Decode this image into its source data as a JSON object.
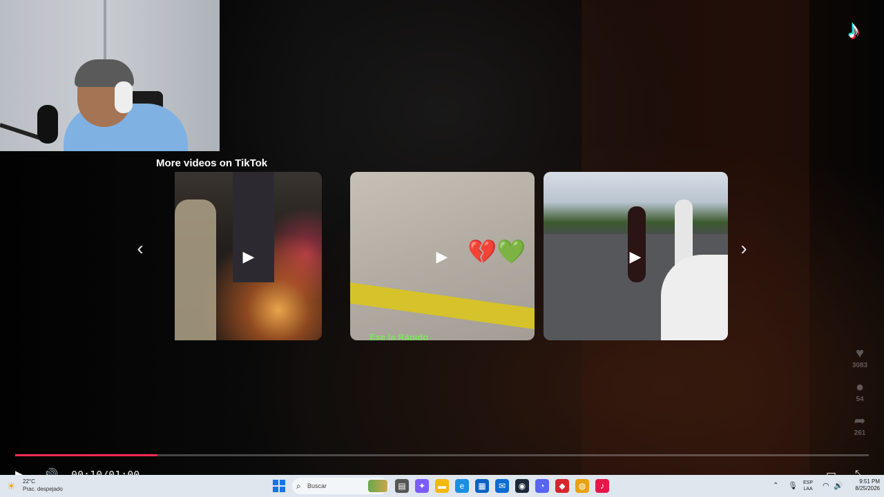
{
  "player": {
    "logo_glyph": "♪",
    "more_videos_title": "More videos on TikTok",
    "prev_glyph": "‹",
    "next_glyph": "›",
    "play_glyph": "▶",
    "thumbnails": [
      {
        "caption": "",
        "emoji": ""
      },
      {
        "caption": "Ese la Rápido",
        "emoji": "💔💚"
      },
      {
        "caption": "",
        "emoji": ""
      }
    ],
    "actions": {
      "like": {
        "glyph": "♥",
        "count": "3083"
      },
      "comment": {
        "glyph": "●",
        "count": "54"
      },
      "share": {
        "glyph": "➦",
        "count": "261"
      }
    },
    "progress_fraction": 0.167,
    "controls": {
      "play_glyph": "▶",
      "volume_glyph": "🔊",
      "time": "00:10/01:00",
      "caption_glyph": "▭",
      "fullscreen_glyph": "⤡"
    },
    "accent_color": "#fe2c55"
  },
  "taskbar": {
    "weather": {
      "temp": "22°C",
      "desc": "Prac. despejado",
      "icon": "☀"
    },
    "search_placeholder": "Buscar",
    "search_icon": "⌕",
    "apps": [
      {
        "name": "file-manager-icon",
        "glyph": "▤",
        "color": "#555555"
      },
      {
        "name": "copilot-icon",
        "glyph": "✦",
        "color": "#7c5cff"
      },
      {
        "name": "folder-icon",
        "glyph": "▬",
        "color": "#f2b90a"
      },
      {
        "name": "edge-icon",
        "glyph": "e",
        "color": "#1b8ee0"
      },
      {
        "name": "store-icon",
        "glyph": "▦",
        "color": "#0b62c4"
      },
      {
        "name": "mail-icon",
        "glyph": "✉",
        "color": "#0e6bd1"
      },
      {
        "name": "steam-icon",
        "glyph": "◉",
        "color": "#1b2838"
      },
      {
        "name": "discord-icon",
        "glyph": "◔",
        "color": "#5865f2"
      },
      {
        "name": "game-icon",
        "glyph": "◆",
        "color": "#d7262d"
      },
      {
        "name": "chrome-icon",
        "glyph": "◍",
        "color": "#e8a20d"
      },
      {
        "name": "tiktok-icon",
        "glyph": "♪",
        "color": "#e8174a"
      }
    ],
    "tray": {
      "chevron": "⌃",
      "mic": "🎙",
      "lang_line1": "ESP",
      "lang_line2": "LAA",
      "wifi": "◠",
      "volume": "🔊",
      "time": "9:51 PM",
      "date": "8/25/2026"
    }
  }
}
